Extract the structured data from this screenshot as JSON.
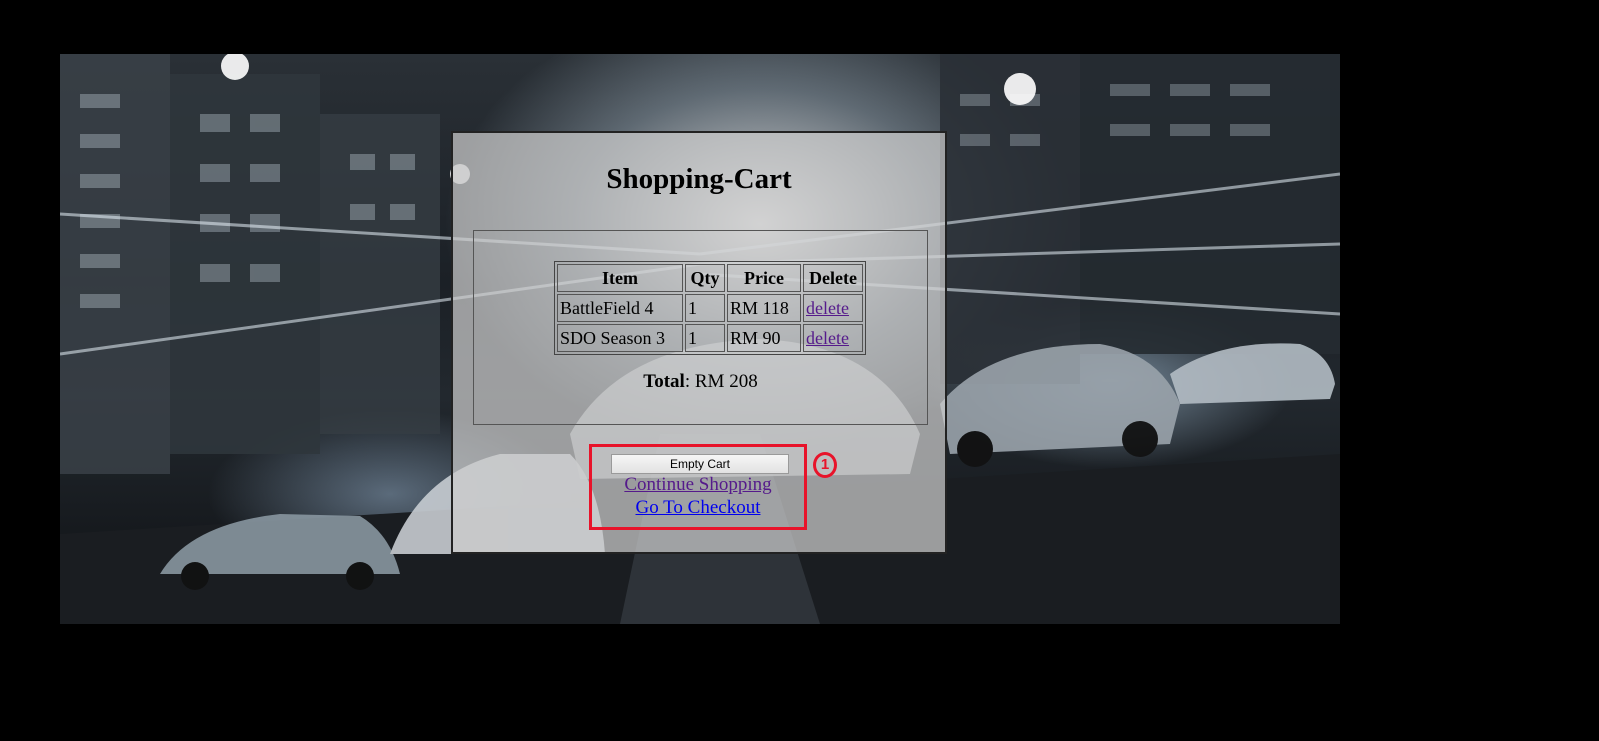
{
  "page": {
    "title": "Shopping-Cart"
  },
  "cart": {
    "headers": {
      "item": "Item",
      "qty": "Qty",
      "price": "Price",
      "delete": "Delete"
    },
    "rows": [
      {
        "item": "BattleField 4",
        "qty": "1",
        "price": "RM 118",
        "delete": "delete"
      },
      {
        "item": "SDO Season 3",
        "qty": "1",
        "price": "RM 90",
        "delete": "delete"
      }
    ],
    "total_label": "Total",
    "total_value": ": RM 208"
  },
  "actions": {
    "empty_cart_label": "Empty Cart",
    "continue_label": "Continue Shopping",
    "checkout_label": "Go To Checkout"
  },
  "annotation": {
    "badge_number": "1",
    "color": "#e8132a"
  },
  "colors": {
    "visited_link": "#551a8b",
    "link": "#0000ee",
    "page_background": "#000000"
  }
}
